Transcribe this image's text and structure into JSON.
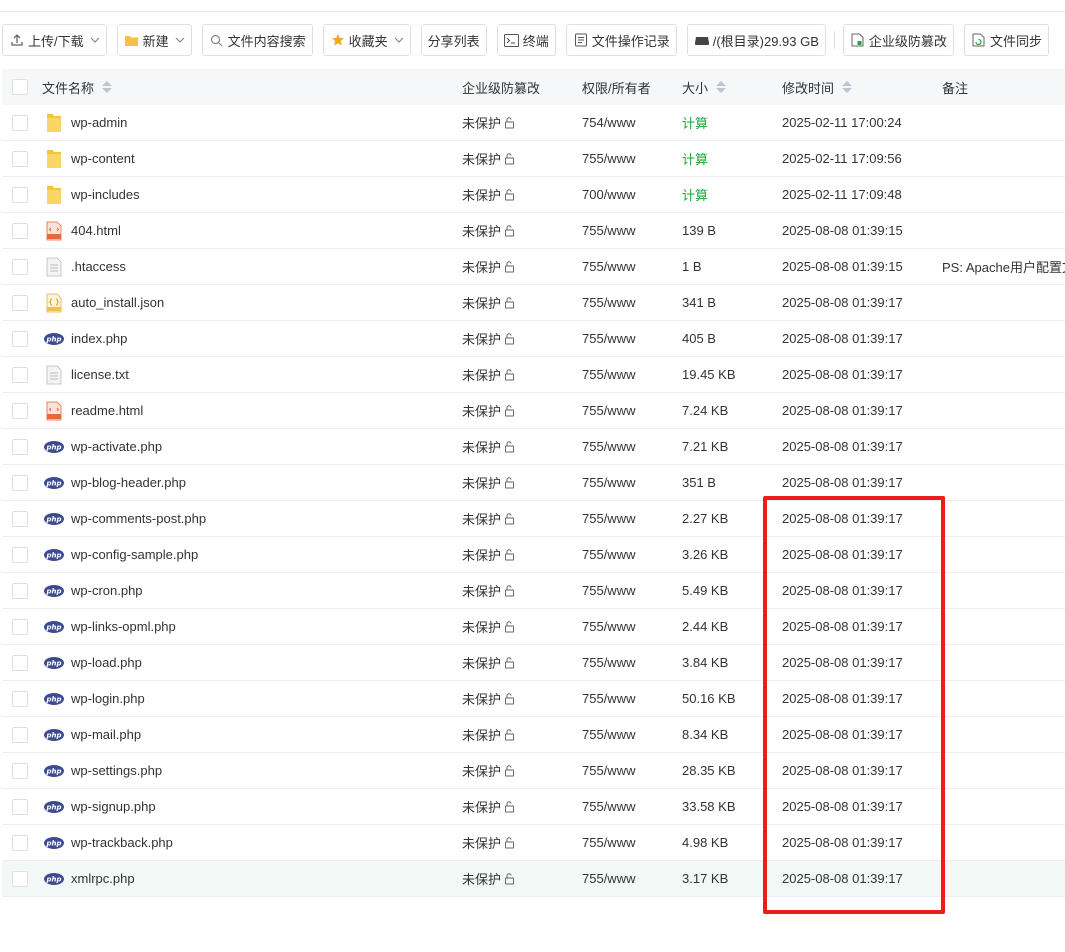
{
  "toolbar": {
    "upload_label": "上传/下载",
    "new_label": "新建",
    "search_label": "文件内容搜索",
    "favorites_label": "收藏夹",
    "share_label": "分享列表",
    "terminal_label": "终端",
    "oplog_label": "文件操作记录",
    "disk_label": "/(根目录)29.93 GB",
    "tamper_label": "企业级防篡改",
    "sync_label": "文件同步"
  },
  "table": {
    "headers": {
      "name": "文件名称",
      "tamper": "企业级防篡改",
      "perm": "权限/所有者",
      "size": "大小",
      "mtime": "修改时间",
      "note": "备注"
    },
    "rows": [
      {
        "icon": "folder-icon",
        "name": "wp-admin",
        "tamper": "未保护",
        "perm": "754/www",
        "size": "计算",
        "mtime": "2025-02-11 17:00:24",
        "note": ""
      },
      {
        "icon": "folder-icon",
        "name": "wp-content",
        "tamper": "未保护",
        "perm": "755/www",
        "size": "计算",
        "mtime": "2025-02-11 17:09:56",
        "note": ""
      },
      {
        "icon": "folder-icon",
        "name": "wp-includes",
        "tamper": "未保护",
        "perm": "700/www",
        "size": "计算",
        "mtime": "2025-02-11 17:09:48",
        "note": ""
      },
      {
        "icon": "html-file-icon",
        "name": "404.html",
        "tamper": "未保护",
        "perm": "755/www",
        "size": "139 B",
        "mtime": "2025-08-08 01:39:15",
        "note": ""
      },
      {
        "icon": "text-file-icon",
        "name": ".htaccess",
        "tamper": "未保护",
        "perm": "755/www",
        "size": "1 B",
        "mtime": "2025-08-08 01:39:15",
        "note": "PS: Apache用户配置文"
      },
      {
        "icon": "json-file-icon",
        "name": "auto_install.json",
        "tamper": "未保护",
        "perm": "755/www",
        "size": "341 B",
        "mtime": "2025-08-08 01:39:17",
        "note": ""
      },
      {
        "icon": "php-file-icon",
        "name": "index.php",
        "tamper": "未保护",
        "perm": "755/www",
        "size": "405 B",
        "mtime": "2025-08-08 01:39:17",
        "note": ""
      },
      {
        "icon": "text-file-icon",
        "name": "license.txt",
        "tamper": "未保护",
        "perm": "755/www",
        "size": "19.45 KB",
        "mtime": "2025-08-08 01:39:17",
        "note": ""
      },
      {
        "icon": "html-file-icon",
        "name": "readme.html",
        "tamper": "未保护",
        "perm": "755/www",
        "size": "7.24 KB",
        "mtime": "2025-08-08 01:39:17",
        "note": ""
      },
      {
        "icon": "php-file-icon",
        "name": "wp-activate.php",
        "tamper": "未保护",
        "perm": "755/www",
        "size": "7.21 KB",
        "mtime": "2025-08-08 01:39:17",
        "note": ""
      },
      {
        "icon": "php-file-icon",
        "name": "wp-blog-header.php",
        "tamper": "未保护",
        "perm": "755/www",
        "size": "351 B",
        "mtime": "2025-08-08 01:39:17",
        "note": ""
      },
      {
        "icon": "php-file-icon",
        "name": "wp-comments-post.php",
        "tamper": "未保护",
        "perm": "755/www",
        "size": "2.27 KB",
        "mtime": "2025-08-08 01:39:17",
        "note": ""
      },
      {
        "icon": "php-file-icon",
        "name": "wp-config-sample.php",
        "tamper": "未保护",
        "perm": "755/www",
        "size": "3.26 KB",
        "mtime": "2025-08-08 01:39:17",
        "note": ""
      },
      {
        "icon": "php-file-icon",
        "name": "wp-cron.php",
        "tamper": "未保护",
        "perm": "755/www",
        "size": "5.49 KB",
        "mtime": "2025-08-08 01:39:17",
        "note": ""
      },
      {
        "icon": "php-file-icon",
        "name": "wp-links-opml.php",
        "tamper": "未保护",
        "perm": "755/www",
        "size": "2.44 KB",
        "mtime": "2025-08-08 01:39:17",
        "note": ""
      },
      {
        "icon": "php-file-icon",
        "name": "wp-load.php",
        "tamper": "未保护",
        "perm": "755/www",
        "size": "3.84 KB",
        "mtime": "2025-08-08 01:39:17",
        "note": ""
      },
      {
        "icon": "php-file-icon",
        "name": "wp-login.php",
        "tamper": "未保护",
        "perm": "755/www",
        "size": "50.16 KB",
        "mtime": "2025-08-08 01:39:17",
        "note": ""
      },
      {
        "icon": "php-file-icon",
        "name": "wp-mail.php",
        "tamper": "未保护",
        "perm": "755/www",
        "size": "8.34 KB",
        "mtime": "2025-08-08 01:39:17",
        "note": ""
      },
      {
        "icon": "php-file-icon",
        "name": "wp-settings.php",
        "tamper": "未保护",
        "perm": "755/www",
        "size": "28.35 KB",
        "mtime": "2025-08-08 01:39:17",
        "note": ""
      },
      {
        "icon": "php-file-icon",
        "name": "wp-signup.php",
        "tamper": "未保护",
        "perm": "755/www",
        "size": "33.58 KB",
        "mtime": "2025-08-08 01:39:17",
        "note": ""
      },
      {
        "icon": "php-file-icon",
        "name": "wp-trackback.php",
        "tamper": "未保护",
        "perm": "755/www",
        "size": "4.98 KB",
        "mtime": "2025-08-08 01:39:17",
        "note": ""
      },
      {
        "icon": "php-file-icon",
        "name": "xmlrpc.php",
        "tamper": "未保护",
        "perm": "755/www",
        "size": "3.17 KB",
        "mtime": "2025-08-08 01:39:17",
        "note": ""
      }
    ],
    "highlighted_row_index": 21
  },
  "colors": {
    "accent_green": "#20a53a",
    "annotation_red": "#ee1c1c",
    "folder_yellow": "#f5c343",
    "php_navy": "#3c4a8e",
    "html_orange": "#e8693a"
  }
}
